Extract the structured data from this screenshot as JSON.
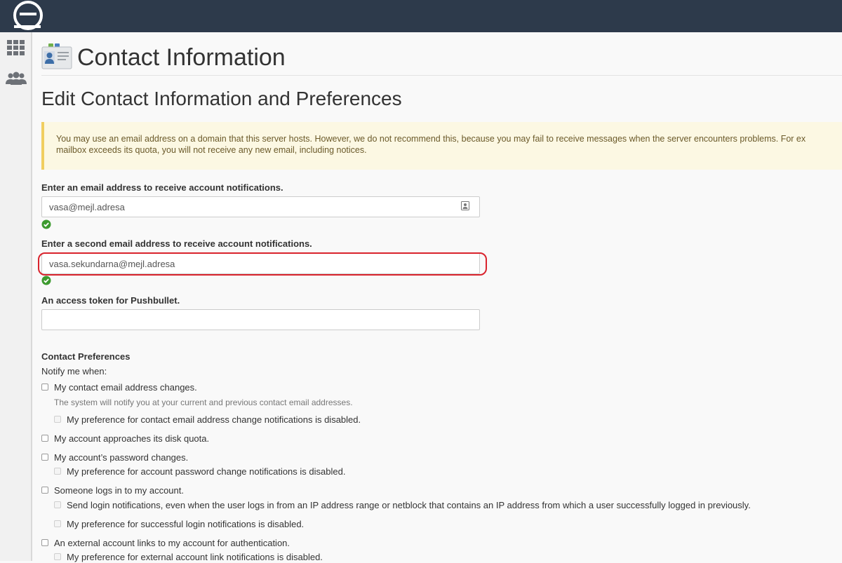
{
  "page": {
    "title": "Contact Information",
    "section_title": "Edit Contact Information and Preferences"
  },
  "alert": {
    "line1": "You may use an email address on a domain that this server hosts. However, we do not recommend this, because you may fail to receive messages when the server encounters problems. For ex",
    "line2": "mailbox exceeds its quota, you will not receive any new email, including notices."
  },
  "form": {
    "email1": {
      "label": "Enter an email address to receive account notifications.",
      "value": "vasa@mejl.adresa"
    },
    "email2": {
      "label": "Enter a second email address to receive account notifications.",
      "value": "vasa.sekundarna@mejl.adresa"
    },
    "pushbullet": {
      "label": "An access token for Pushbullet.",
      "value": ""
    }
  },
  "preferences": {
    "title": "Contact Preferences",
    "notify_text": "Notify me when:",
    "contact_email_changes": "My contact email address changes.",
    "contact_email_helper": "The system will notify you at your current and previous contact email addresses.",
    "contact_email_disabled": "My preference for contact email address change notifications is disabled.",
    "disk_quota": "My account approaches its disk quota.",
    "password_changes": "My account’s password changes.",
    "password_disabled": "My preference for account password change notifications is disabled.",
    "login": "Someone logs in to my account.",
    "login_netblock": "Send login notifications, even when the user logs in from an IP address range or netblock that contains an IP address from which a user successfully logged in previously.",
    "login_disabled": "My preference for successful login notifications is disabled.",
    "external_link": "An external account links to my account for authentication.",
    "external_link_disabled": "My preference for external account link notifications is disabled."
  },
  "colors": {
    "topbar": "#2d3a4b",
    "alert_bg": "#fcf8e3",
    "alert_border": "#f0ce60",
    "success": "#3c9a2e",
    "highlight": "#d9232d"
  }
}
